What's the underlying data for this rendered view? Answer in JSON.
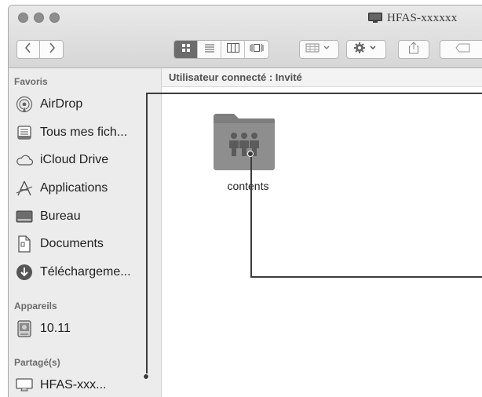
{
  "window": {
    "title": "HFAS-xxxxxx",
    "title_icon": "monitor-icon"
  },
  "toolbar": {
    "back_icon": "chevron-left-icon",
    "forward_icon": "chevron-right-icon",
    "view_modes": [
      "icon-view",
      "list-view",
      "column-view",
      "cover-flow-view"
    ],
    "active_view": "icon-view",
    "arrange_icon": "arrange-grid-icon",
    "action_icon": "gear-icon",
    "share_icon": "share-icon",
    "tag_icon": "tag-icon"
  },
  "sidebar": {
    "favorites_heading": "Favoris",
    "favorites": [
      {
        "label": "AirDrop",
        "icon": "airdrop-icon"
      },
      {
        "label": "Tous mes fich...",
        "icon": "all-files-icon"
      },
      {
        "label": "iCloud Drive",
        "icon": "cloud-icon"
      },
      {
        "label": "Applications",
        "icon": "applications-icon"
      },
      {
        "label": "Bureau",
        "icon": "desktop-icon"
      },
      {
        "label": "Documents",
        "icon": "documents-icon"
      },
      {
        "label": "Téléchargeme...",
        "icon": "download-icon"
      }
    ],
    "devices_heading": "Appareils",
    "devices": [
      {
        "label": "10.11",
        "icon": "disk-icon"
      }
    ],
    "shared_heading": "Partagé(s)",
    "shared": [
      {
        "label": "HFAS-xxx...",
        "icon": "monitor-icon"
      }
    ]
  },
  "main": {
    "path_text": "Utilisateur connecté : Invité",
    "items": [
      {
        "label": "contents",
        "icon": "shared-folder-icon"
      }
    ]
  },
  "colors": {
    "titlebar": "#dedede",
    "sidebar_bg": "#ececec",
    "folder": "#8a8a8a",
    "callout": "#3c3c3c"
  }
}
